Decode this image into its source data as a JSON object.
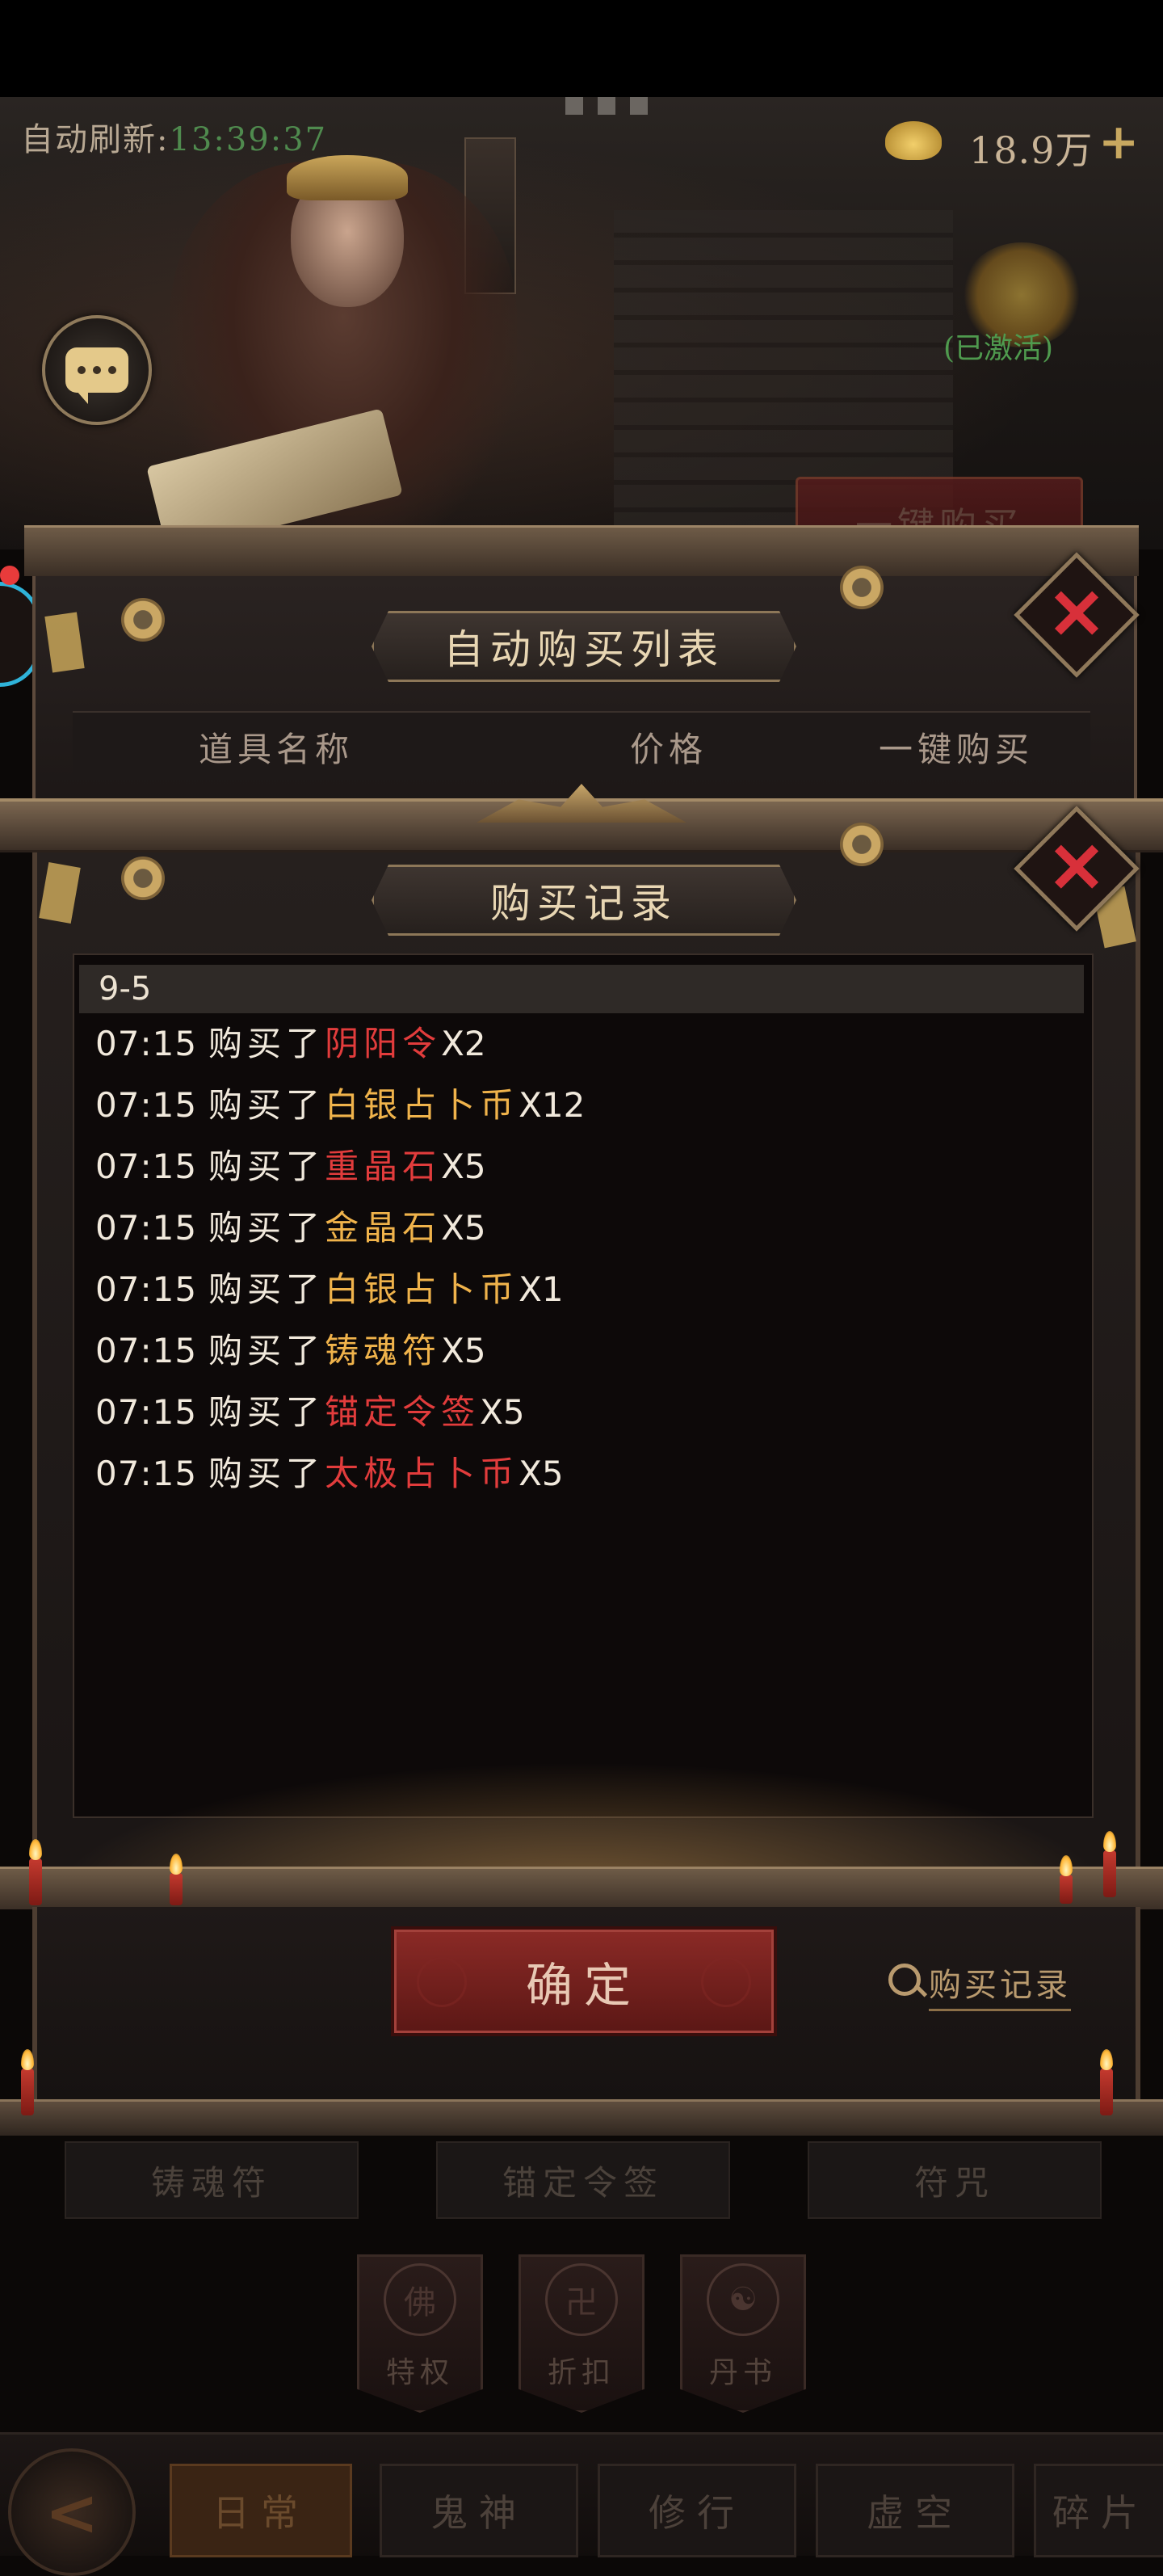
{
  "header": {
    "auto_refresh_label": "自动刷新:",
    "auto_refresh_time": "13:39:37",
    "currency_amount": "18.9万",
    "currency_plus": "+",
    "activated_status": "(已激活)"
  },
  "top_actions": {
    "buy_all_label": "一键购买"
  },
  "auto_buy_panel": {
    "title": "自动购买列表",
    "columns": [
      "道具名称",
      "价格",
      "一键购买"
    ]
  },
  "record_panel": {
    "title": "购买记录",
    "date": "9-5",
    "verb": "购买了",
    "records": [
      {
        "time": "07:15",
        "item": "阴阳令",
        "qty": "X2",
        "color": "red"
      },
      {
        "time": "07:15",
        "item": "白银占卜币",
        "qty": "X12",
        "color": "gold"
      },
      {
        "time": "07:15",
        "item": "重晶石",
        "qty": "X5",
        "color": "red"
      },
      {
        "time": "07:15",
        "item": "金晶石",
        "qty": "X5",
        "color": "gold"
      },
      {
        "time": "07:15",
        "item": "白银占卜币",
        "qty": "X1",
        "color": "gold"
      },
      {
        "time": "07:15",
        "item": "铸魂符",
        "qty": "X5",
        "color": "gold"
      },
      {
        "time": "07:15",
        "item": "锚定令签",
        "qty": "X5",
        "color": "red"
      },
      {
        "time": "07:15",
        "item": "太极占卜币",
        "qty": "X5",
        "color": "red"
      }
    ],
    "confirm_label": "确定",
    "record_link_label": "购买记录"
  },
  "background_tabs": {
    "items": [
      "铸魂符",
      "锚定令签",
      "符咒"
    ]
  },
  "feature_banners": [
    {
      "label": "特权",
      "glyph": "佛"
    },
    {
      "label": "折扣",
      "glyph": "卍"
    },
    {
      "label": "丹书",
      "glyph": "☯"
    }
  ],
  "bottom_nav": {
    "back_glyph": "<",
    "tabs": [
      "日常",
      "鬼神",
      "修行",
      "虚空",
      "碎片"
    ]
  },
  "colors": {
    "record_red": "#e23c3c",
    "record_gold": "#f0b34b",
    "refresh_time_green": "#4f8a4e",
    "close_red": "#d8303a",
    "confirm_red": "#8b2a26"
  },
  "icons": [
    "chat-icon",
    "gold-ingot-icon",
    "plus-icon",
    "close-icon",
    "search-icon",
    "back-arrow-icon"
  ]
}
